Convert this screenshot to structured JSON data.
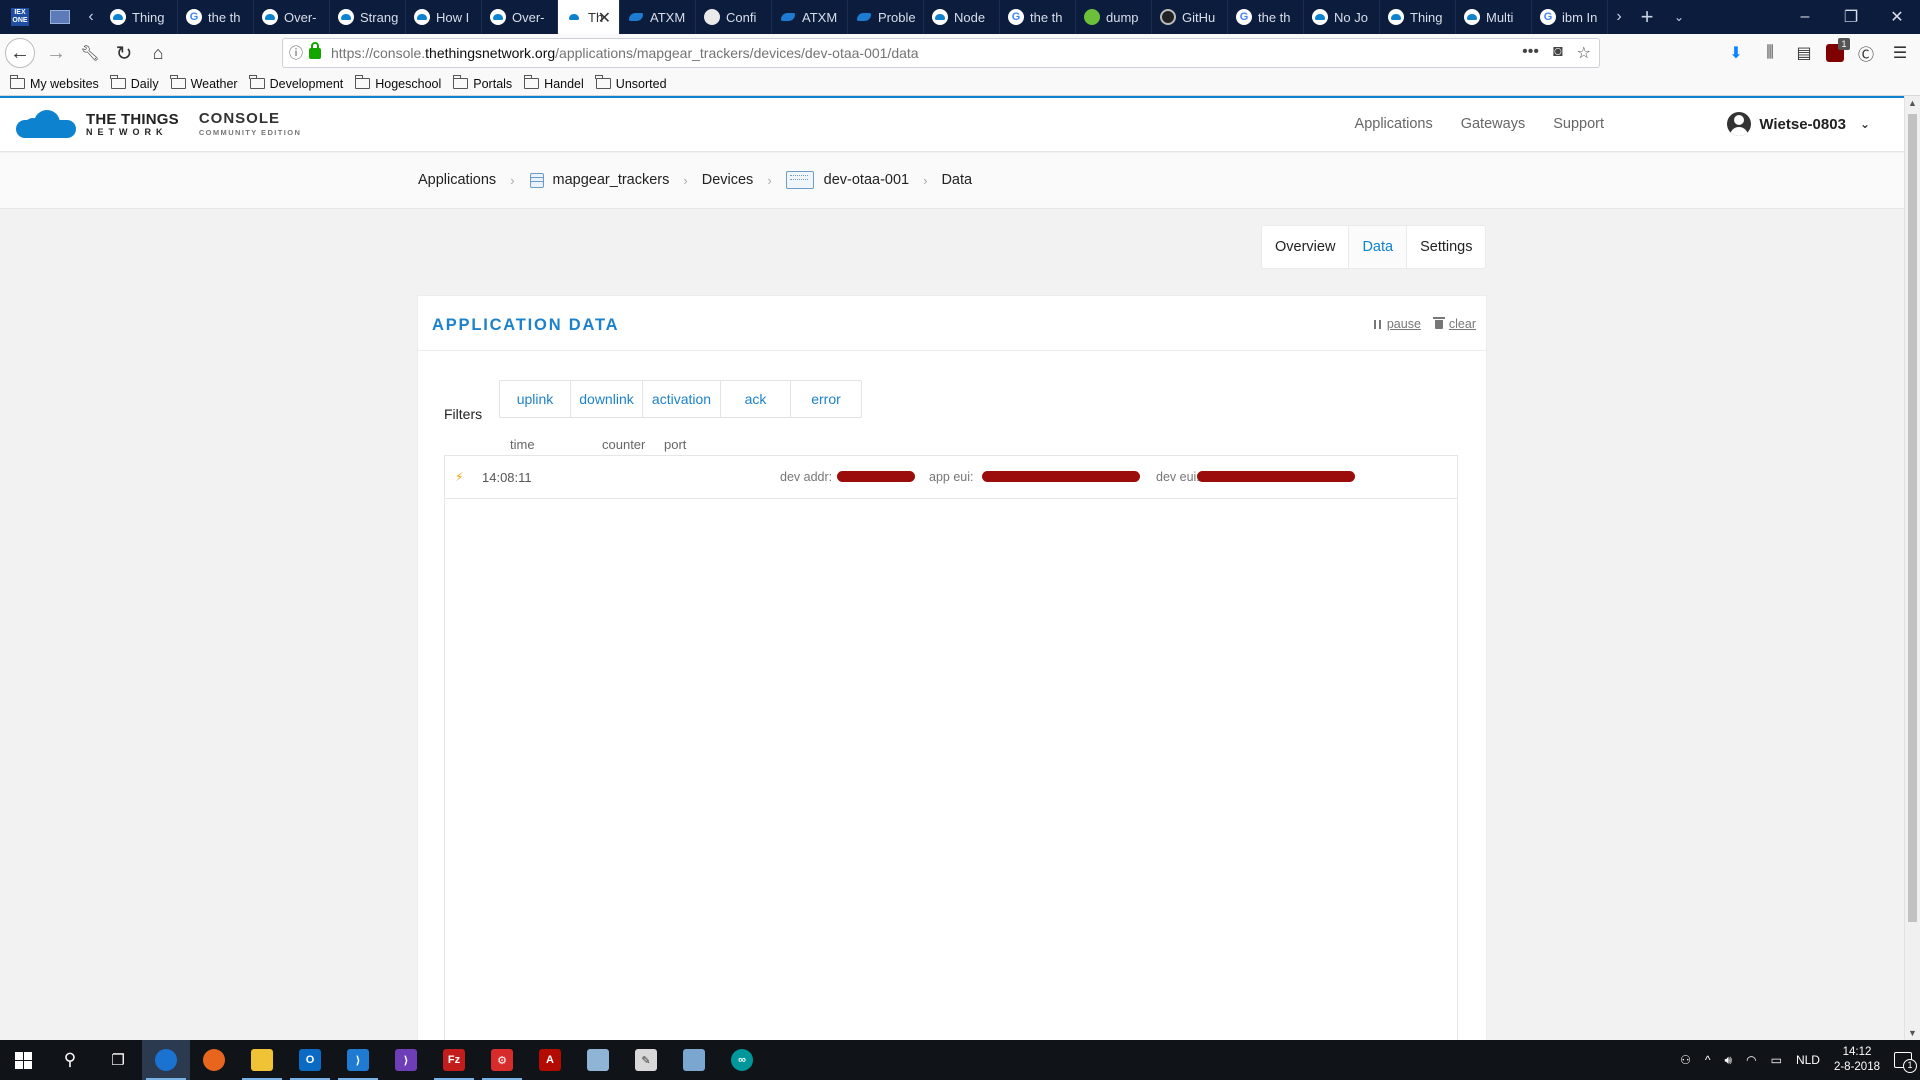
{
  "browser": {
    "tabs": [
      {
        "label": "Thing",
        "icon": "ttn"
      },
      {
        "label": "the th",
        "icon": "google"
      },
      {
        "label": "Over-",
        "icon": "ttn"
      },
      {
        "label": "Strang",
        "icon": "ttn"
      },
      {
        "label": "How I",
        "icon": "ttn"
      },
      {
        "label": "Over-",
        "icon": "ttn"
      },
      {
        "label": "Th",
        "icon": "ttn",
        "active": true
      },
      {
        "label": "ATXM",
        "icon": "atx"
      },
      {
        "label": "Confi",
        "icon": "conf"
      },
      {
        "label": "ATXM",
        "icon": "atx"
      },
      {
        "label": "Proble",
        "icon": "atx"
      },
      {
        "label": "Node",
        "icon": "ttn"
      },
      {
        "label": "the th",
        "icon": "google"
      },
      {
        "label": "dump",
        "icon": "dump"
      },
      {
        "label": "GitHu",
        "icon": "github"
      },
      {
        "label": "the th",
        "icon": "google"
      },
      {
        "label": "No Jo",
        "icon": "ttn"
      },
      {
        "label": "Thing",
        "icon": "ttn"
      },
      {
        "label": "Multi",
        "icon": "ttn"
      },
      {
        "label": "ibm In",
        "icon": "google"
      }
    ],
    "url": {
      "prefix": "https://console.",
      "domain": "thethingsnetwork.org",
      "path": "/applications/mapgear_trackers/devices/dev-otaa-001/data"
    },
    "bookmarks": [
      "My websites",
      "Daily",
      "Weather",
      "Development",
      "Hogeschool",
      "Portals",
      "Handel",
      "Unsorted"
    ]
  },
  "header": {
    "brand_line1": "THE THINGS",
    "brand_line2": "NETWORK",
    "console_line1": "CONSOLE",
    "console_line2": "COMMUNITY EDITION",
    "nav": [
      "Applications",
      "Gateways",
      "Support"
    ],
    "username": "Wietse-0803"
  },
  "breadcrumb": {
    "applications": "Applications",
    "app_id": "mapgear_trackers",
    "devices": "Devices",
    "device_id": "dev-otaa-001",
    "current": "Data"
  },
  "subtabs": [
    "Overview",
    "Data",
    "Settings"
  ],
  "panel": {
    "title": "APPLICATION DATA",
    "pause_label": "pause",
    "clear_label": "clear",
    "filters_label": "Filters",
    "filters": [
      "uplink",
      "downlink",
      "activation",
      "ack",
      "error"
    ],
    "columns": [
      "time",
      "counter",
      "port"
    ],
    "events": [
      {
        "time": "14:08:11",
        "dev_addr_label": "dev addr:",
        "app_eui_label": "app eui:",
        "dev_eui_label": "dev eui:"
      }
    ]
  },
  "taskbar": {
    "language": "NLD",
    "time": "14:12",
    "date": "2-8-2018"
  }
}
